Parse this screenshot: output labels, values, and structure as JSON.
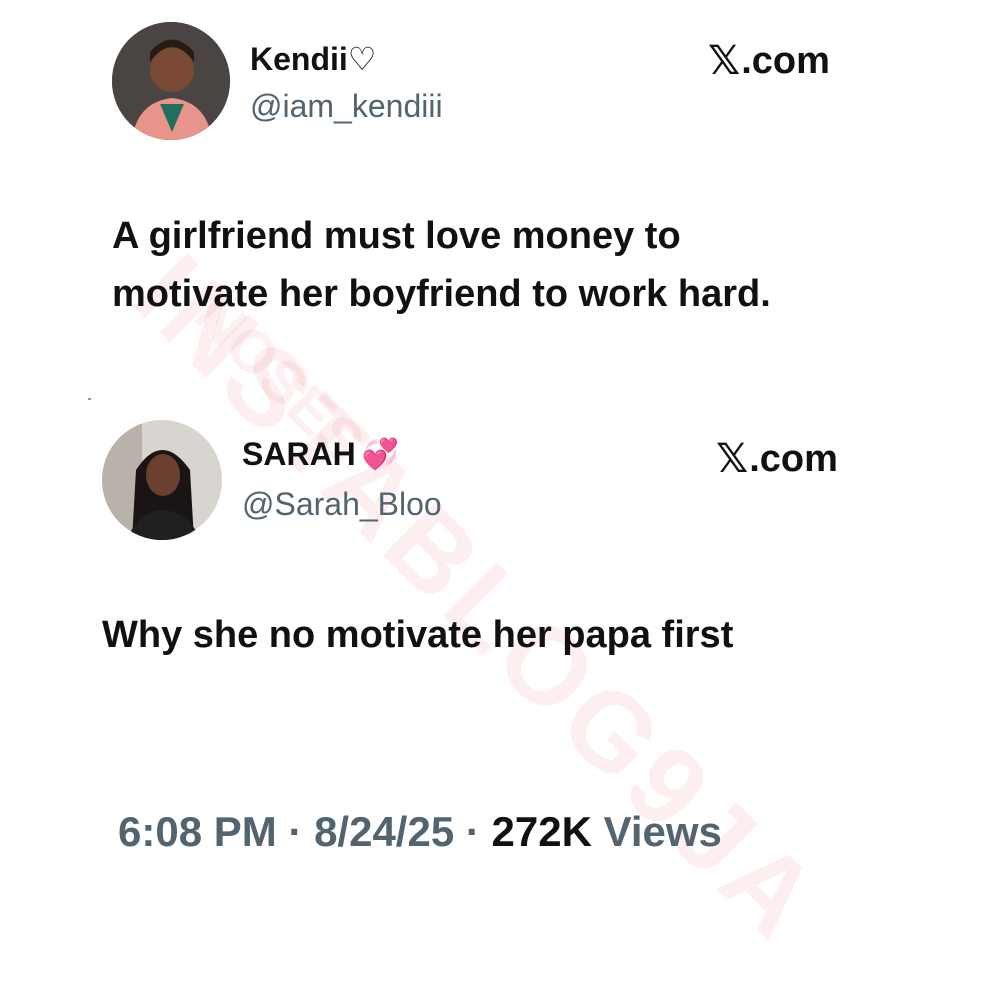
{
  "tweet1": {
    "name": "Kendii♡",
    "handle": "@iam_kendiii",
    "site": ".com",
    "site_mark": "𝕏",
    "text": "A girlfriend must love money to motivate her boyfriend to work hard."
  },
  "tweet2": {
    "name": "SARAH",
    "name_emoji": "💞",
    "handle": "@Sarah_Bloo",
    "site": ".com",
    "site_mark": "𝕏",
    "text": "Why she no motivate her papa first"
  },
  "footer": {
    "time": "6:08 PM",
    "sep1": " · ",
    "date": "8/24/25",
    "sep2": " · ",
    "views_count": "272K",
    "views_label": " Views"
  },
  "watermark": {
    "text": "INSTABLOG9JA",
    "sub": "NOSES"
  },
  "colors": {
    "text": "#111111",
    "secondary": "#536471",
    "watermark": "#f07882"
  }
}
